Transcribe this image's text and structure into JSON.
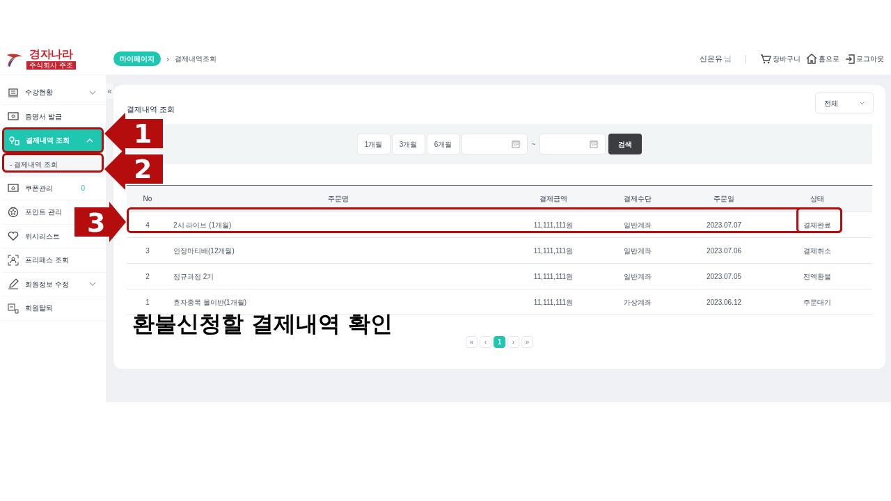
{
  "logo": {
    "name": "경자나라",
    "subtitle": "주식회사 주조"
  },
  "breadcrumb": [
    {
      "label": "마이페이지",
      "kind": "pill"
    },
    {
      "label": "›",
      "kind": "separator"
    },
    {
      "label": "결제내역조회",
      "kind": "text"
    }
  ],
  "header": {
    "user": "신온유",
    "honorific": "님",
    "links": [
      {
        "label": "장바구니"
      },
      {
        "label": "홈으로"
      },
      {
        "label": "로그아웃"
      }
    ]
  },
  "sidebar": {
    "collapse": "«",
    "items": [
      {
        "label": "수강현황",
        "expanded": false,
        "selected": false
      },
      {
        "label": "증명서 발급",
        "selected": false
      },
      {
        "label": "결제내역 조회",
        "expanded": true,
        "selected": true,
        "children": [
          {
            "label": "- 결제내역 조회"
          }
        ]
      },
      {
        "label": "쿠폰관리",
        "selected": false,
        "count": "0"
      },
      {
        "label": "포인트 관리",
        "selected": false
      },
      {
        "label": "위시리스트",
        "selected": false
      },
      {
        "label": "프리패스 조회",
        "selected": false
      },
      {
        "label": "회원정보 수정",
        "expanded": false,
        "selected": false
      },
      {
        "label": "회원탈퇴",
        "selected": false
      }
    ]
  },
  "page_title": "결제내역 조회",
  "status_filter": {
    "value": "전체"
  },
  "period_buttons": [
    "1개월",
    "3개월",
    "6개월"
  ],
  "date_separator": "~",
  "search_button": "검색",
  "table": {
    "columns": [
      "No",
      "주문명",
      "결제금액",
      "결제수단",
      "주문일",
      "상태"
    ],
    "rows": [
      {
        "no": "4",
        "name": "2시 라이브 (1개월)",
        "amount": "11,111,111원",
        "method": "일반계좌",
        "date": "2023.07.07",
        "status": "결제완료"
      },
      {
        "no": "3",
        "name": "인정마티배(12개월)",
        "amount": "11,111,111원",
        "method": "일반계좌",
        "date": "2023.07.06",
        "status": "결제취소"
      },
      {
        "no": "2",
        "name": "정규과정 2기",
        "amount": "11,111,111원",
        "method": "일반계좌",
        "date": "2023.07.05",
        "status": "전액환불"
      },
      {
        "no": "1",
        "name": "효자종목 몰이반(1개월)",
        "amount": "11,111,111원",
        "method": "가상계좌",
        "date": "2023.06.12",
        "status": "주문대기"
      }
    ]
  },
  "pagination": [
    {
      "label": "«",
      "selected": false
    },
    {
      "label": "‹",
      "selected": false
    },
    {
      "label": "1",
      "selected": true
    },
    {
      "label": "›",
      "selected": false
    },
    {
      "label": "»",
      "selected": false
    }
  ],
  "annotations": {
    "callouts": [
      "1",
      "2",
      "3"
    ],
    "caption": "환불신청할 결제내역 확인"
  }
}
